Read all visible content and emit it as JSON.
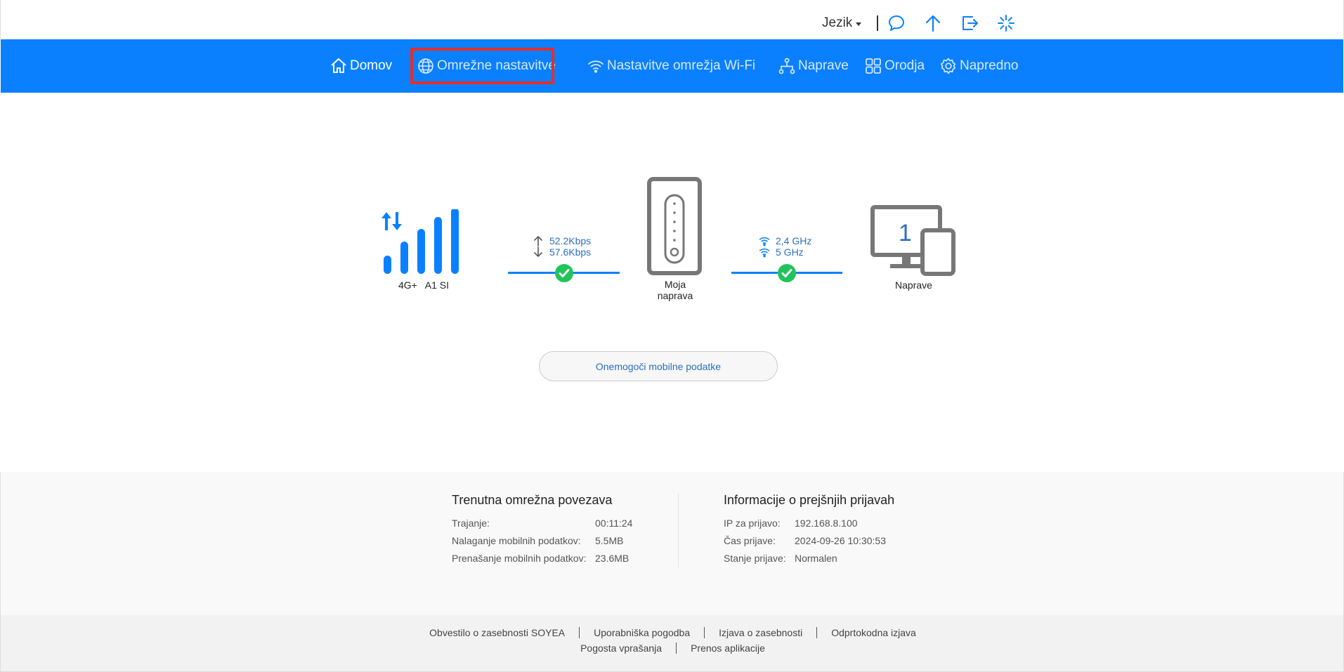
{
  "header": {
    "language_label": "Jezik",
    "icons": [
      "chat-icon",
      "arrow-up-icon",
      "logout-icon",
      "spinner-icon"
    ]
  },
  "nav": {
    "items": [
      {
        "label": "Domov",
        "icon": "home-icon"
      },
      {
        "label": "Omrežne nastavitve",
        "icon": "globe-icon"
      },
      {
        "label": "Nastavitve omrežja Wi-Fi",
        "icon": "wifi-icon"
      },
      {
        "label": "Naprave",
        "icon": "network-tree-icon"
      },
      {
        "label": "Orodja",
        "icon": "grid-icon"
      },
      {
        "label": "Napredno",
        "icon": "gear-icon"
      }
    ],
    "active_color": "#ffffff",
    "bar_color": "#0a80ff",
    "highlight_color": "#e62d2d"
  },
  "diagram": {
    "network_type": "4G+",
    "operator": "A1 SI",
    "upload_rate": "52.2Kbps",
    "download_rate": "57.6Kbps",
    "device_label_line1": "Moja",
    "device_label_line2": "naprava",
    "wifi_band_1": "2,4 GHz",
    "wifi_band_2": "5 GHz",
    "connected_devices_count": "1",
    "connected_devices_label": "Naprave",
    "status_color": "#21c45a"
  },
  "disable_button_label": "Onemogoči mobilne podatke",
  "current_connection": {
    "title": "Trenutna omrežna povezava",
    "rows": [
      {
        "key": "Trajanje:",
        "value": "00:11:24"
      },
      {
        "key": "Nalaganje mobilnih podatkov:",
        "value": "5.5MB"
      },
      {
        "key": "Prenašanje mobilnih podatkov:",
        "value": "23.6MB"
      }
    ]
  },
  "previous_login": {
    "title": "Informacije o prejšnjih prijavah",
    "rows": [
      {
        "key": "IP za prijavo:",
        "value": "192.168.8.100"
      },
      {
        "key": "Čas prijave:",
        "value": "2024-09-26 10:30:53"
      },
      {
        "key": "Stanje prijave:",
        "value": "Normalen"
      }
    ]
  },
  "footer": {
    "row1": [
      "Obvestilo o zasebnosti SOYEA",
      "Uporabniška pogodba",
      "Izjava o zasebnosti",
      "Odprtokodna izjava"
    ],
    "row2": [
      "Pogosta vprašanja",
      "Prenos aplikacije"
    ]
  }
}
